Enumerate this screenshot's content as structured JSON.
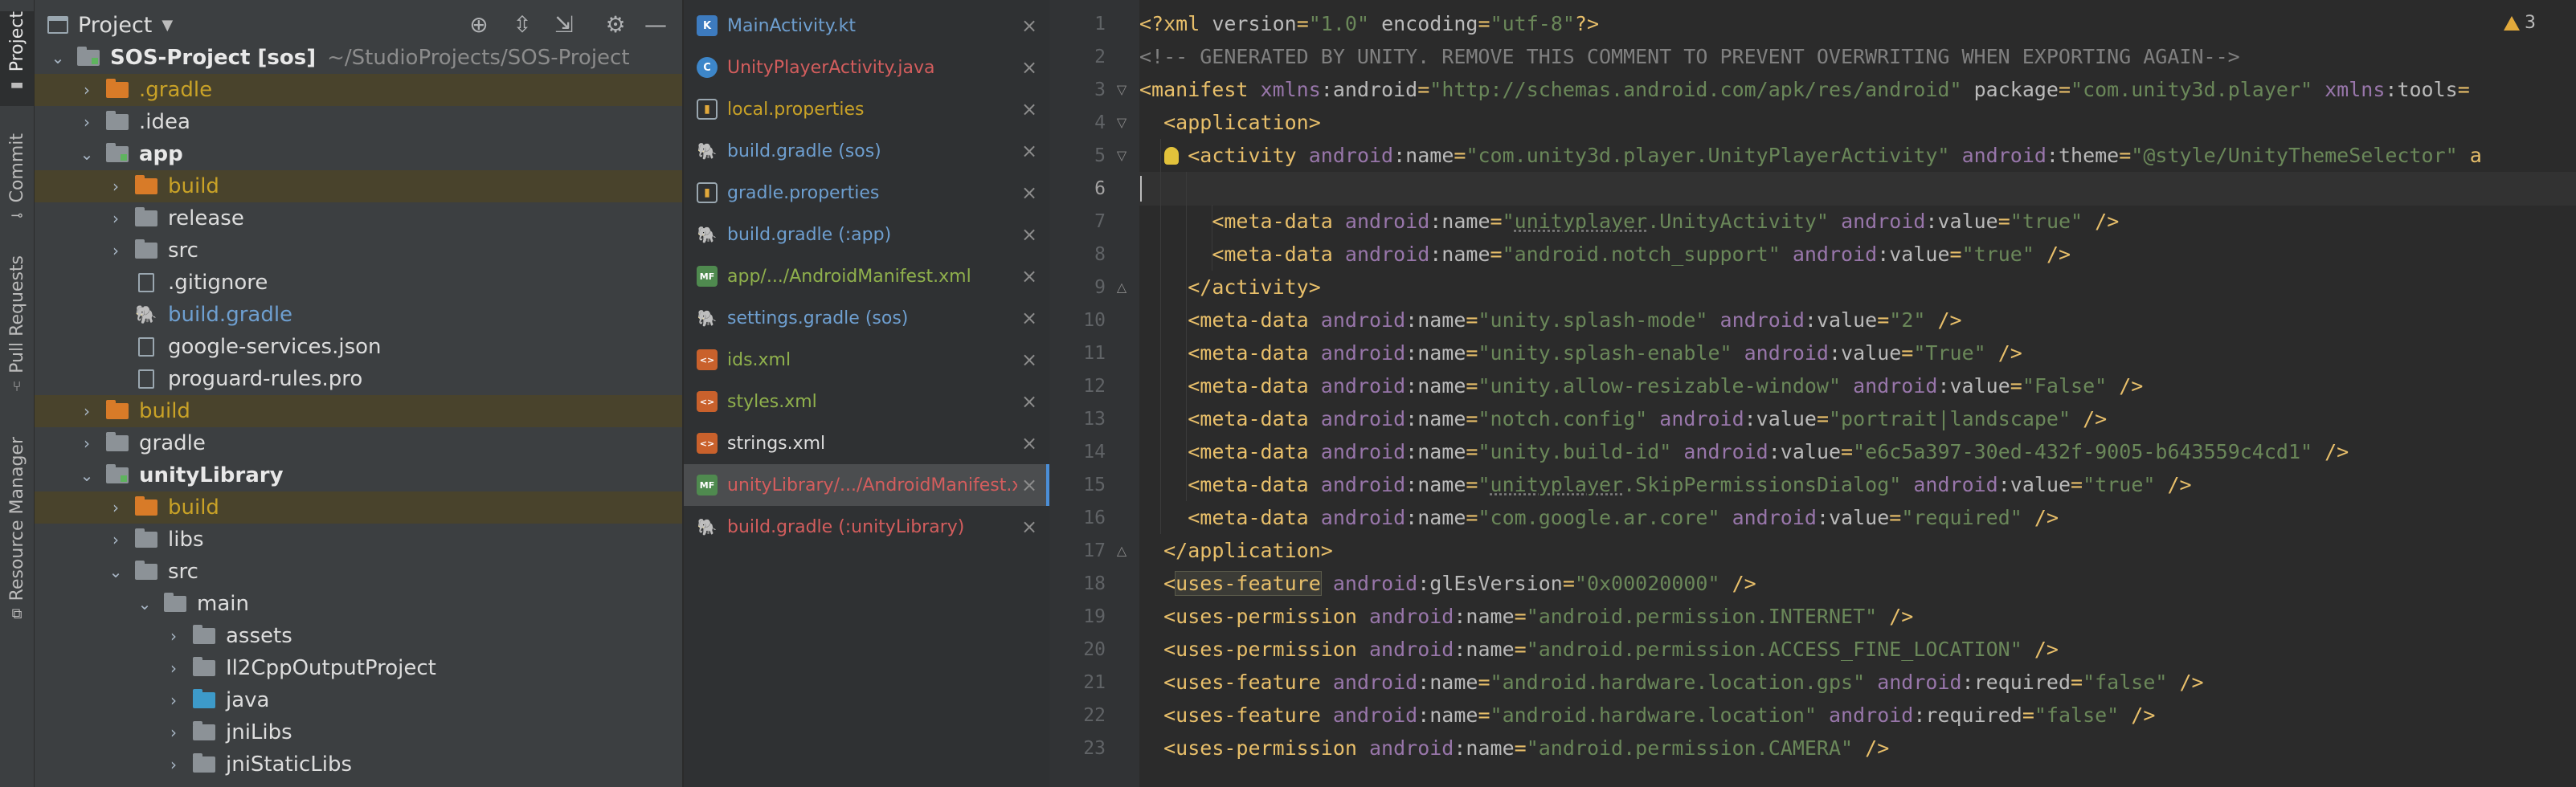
{
  "tool_strip": {
    "tabs": [
      {
        "label": "Project",
        "icon": "folder-icon"
      },
      {
        "label": "Commit",
        "icon": "commit-icon"
      },
      {
        "label": "Pull Requests",
        "icon": "pull-request-icon"
      },
      {
        "label": "Resource Manager",
        "icon": "resource-manager-icon"
      }
    ]
  },
  "project_panel": {
    "title": "Project",
    "tree": [
      {
        "label": "SOS-Project [sos]",
        "path": "~/StudioProjects/SOS-Project",
        "style": "bold",
        "expanded": true,
        "icon": "module"
      },
      {
        "label": ".gradle",
        "style": "yellow",
        "icon": "orange"
      },
      {
        "label": ".idea",
        "style": "normal",
        "icon": "folder"
      },
      {
        "label": "app",
        "style": "bold",
        "expanded": true,
        "icon": "module"
      },
      {
        "label": "build",
        "style": "yellow",
        "icon": "orange"
      },
      {
        "label": "release",
        "style": "normal",
        "icon": "folder"
      },
      {
        "label": "src",
        "style": "normal",
        "icon": "folder"
      },
      {
        "label": ".gitignore",
        "style": "normal",
        "icon": "file"
      },
      {
        "label": "build.gradle",
        "style": "blue",
        "icon": "gradle"
      },
      {
        "label": "google-services.json",
        "style": "normal",
        "icon": "file"
      },
      {
        "label": "proguard-rules.pro",
        "style": "normal",
        "icon": "file"
      },
      {
        "label": "build",
        "style": "yellow",
        "icon": "orange"
      },
      {
        "label": "gradle",
        "style": "normal",
        "icon": "folder"
      },
      {
        "label": "unityLibrary",
        "style": "bold",
        "expanded": true,
        "icon": "module"
      },
      {
        "label": "build",
        "style": "yellow",
        "icon": "orange"
      },
      {
        "label": "libs",
        "style": "normal",
        "icon": "folder"
      },
      {
        "label": "src",
        "style": "normal",
        "expanded": true,
        "icon": "folder"
      },
      {
        "label": "main",
        "style": "normal",
        "expanded": true,
        "icon": "folder"
      },
      {
        "label": "assets",
        "style": "normal",
        "icon": "folder"
      },
      {
        "label": "Il2CppOutputProject",
        "style": "normal",
        "icon": "folder"
      },
      {
        "label": "java",
        "style": "normal",
        "icon": "blue"
      },
      {
        "label": "jniLibs",
        "style": "normal",
        "icon": "folder"
      },
      {
        "label": "jniStaticLibs",
        "style": "normal",
        "icon": "folder"
      }
    ]
  },
  "open_files": [
    {
      "name": "MainActivity.kt",
      "color": "blue"
    },
    {
      "name": "UnityPlayerActivity.java",
      "color": "red"
    },
    {
      "name": "local.properties",
      "color": "yellow"
    },
    {
      "name": "build.gradle (sos)",
      "color": "blue"
    },
    {
      "name": "gradle.properties",
      "color": "blue"
    },
    {
      "name": "build.gradle (:app)",
      "color": "blue"
    },
    {
      "name": "app/.../AndroidManifest.xml",
      "color": "green"
    },
    {
      "name": "settings.gradle (sos)",
      "color": "blue"
    },
    {
      "name": "ids.xml",
      "color": "green"
    },
    {
      "name": "styles.xml",
      "color": "green"
    },
    {
      "name": "strings.xml",
      "color": "normal"
    },
    {
      "name": "unityLibrary/.../AndroidManifest.xml",
      "color": "red",
      "selected": true
    },
    {
      "name": "build.gradle (:unityLibrary)",
      "color": "red"
    }
  ],
  "close_glyph": "×",
  "editor": {
    "warning_count": "3",
    "current_line": 6,
    "lines": [
      {
        "n": "1",
        "text": "<?xml version=\"1.0\" encoding=\"utf-8\"?>"
      },
      {
        "n": "2",
        "text": "<!-- GENERATED BY UNITY. REMOVE THIS COMMENT TO PREVENT OVERWRITING WHEN EXPORTING AGAIN-->"
      },
      {
        "n": "3",
        "text": "<manifest xmlns:android=\"http://schemas.android.com/apk/res/android\" package=\"com.unity3d.player\" xmlns:tools="
      },
      {
        "n": "4",
        "text": "  <application>"
      },
      {
        "n": "5",
        "text": "    <activity android:name=\"com.unity3d.player.UnityPlayerActivity\" android:theme=\"@style/UnityThemeSelector\" a"
      },
      {
        "n": "6",
        "text": ""
      },
      {
        "n": "7",
        "text": "      <meta-data android:name=\"unityplayer.UnityActivity\" android:value=\"true\" />"
      },
      {
        "n": "8",
        "text": "      <meta-data android:name=\"android.notch_support\" android:value=\"true\" />"
      },
      {
        "n": "9",
        "text": "    </activity>"
      },
      {
        "n": "10",
        "text": "    <meta-data android:name=\"unity.splash-mode\" android:value=\"2\" />"
      },
      {
        "n": "11",
        "text": "    <meta-data android:name=\"unity.splash-enable\" android:value=\"True\" />"
      },
      {
        "n": "12",
        "text": "    <meta-data android:name=\"unity.allow-resizable-window\" android:value=\"False\" />"
      },
      {
        "n": "13",
        "text": "    <meta-data android:name=\"notch.config\" android:value=\"portrait|landscape\" />"
      },
      {
        "n": "14",
        "text": "    <meta-data android:name=\"unity.build-id\" android:value=\"e6c5a397-30ed-432f-9005-b643559c4cd1\" />"
      },
      {
        "n": "15",
        "text": "    <meta-data android:name=\"unityplayer.SkipPermissionsDialog\" android:value=\"true\" />"
      },
      {
        "n": "16",
        "text": "    <meta-data android:name=\"com.google.ar.core\" android:value=\"required\" />"
      },
      {
        "n": "17",
        "text": "  </application>"
      },
      {
        "n": "18",
        "text": "  <uses-feature android:glEsVersion=\"0x00020000\" />"
      },
      {
        "n": "19",
        "text": "  <uses-permission android:name=\"android.permission.INTERNET\" />"
      },
      {
        "n": "20",
        "text": "  <uses-permission android:name=\"android.permission.ACCESS_FINE_LOCATION\" />"
      },
      {
        "n": "21",
        "text": "  <uses-feature android:name=\"android.hardware.location.gps\" android:required=\"false\" />"
      },
      {
        "n": "22",
        "text": "  <uses-feature android:name=\"android.hardware.location\" android:required=\"false\" />"
      },
      {
        "n": "23",
        "text": "  <uses-permission android:name=\"android.permission.CAMERA\" />"
      }
    ]
  }
}
